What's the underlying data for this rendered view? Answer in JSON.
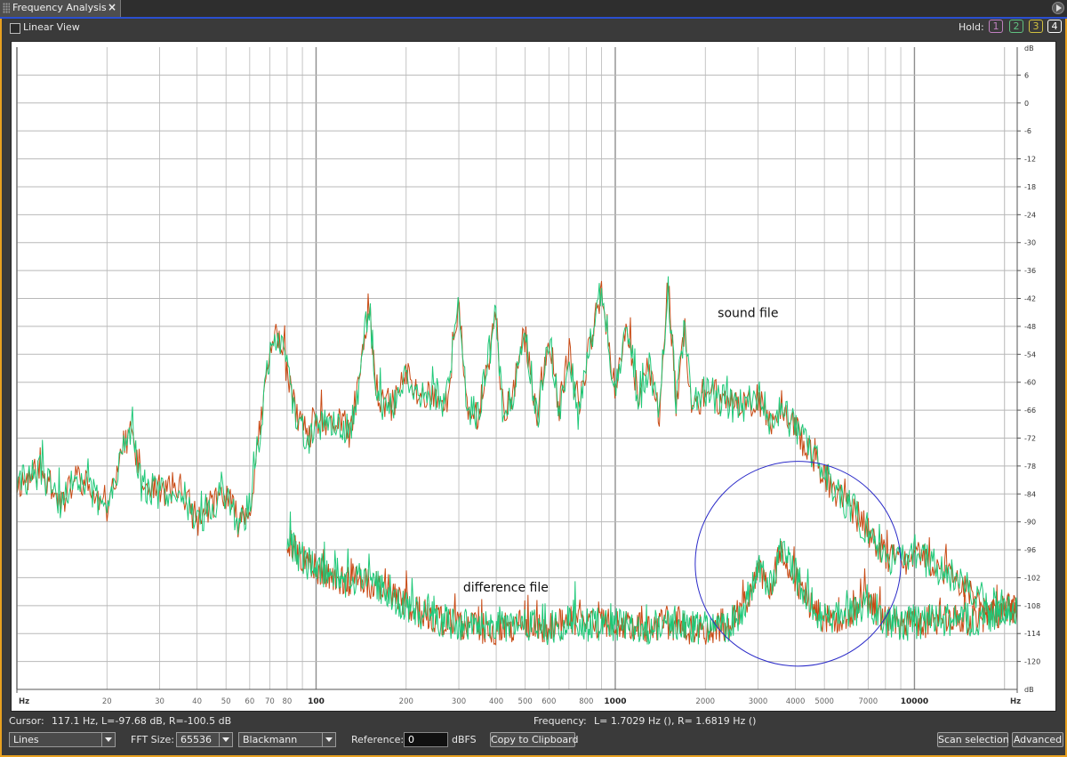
{
  "window": {
    "tab_title": "Frequency Analysis",
    "close_glyph": "×"
  },
  "toolbar": {
    "linear_view_label": "Linear View",
    "hold_label": "Hold:",
    "hold_buttons": [
      {
        "label": "1",
        "color": "#c080c0"
      },
      {
        "label": "2",
        "color": "#60c080"
      },
      {
        "label": "3",
        "color": "#d0c040"
      },
      {
        "label": "4",
        "color": "#ffffff"
      }
    ]
  },
  "status": {
    "cursor_label": "Cursor:",
    "cursor_value": "117.1 Hz, L=-97.68 dB, R=-100.5 dB",
    "frequency_label": "Frequency:",
    "frequency_value": "L= 1.7029 Hz (), R= 1.6819 Hz ()"
  },
  "bottom": {
    "mode_value": "Lines",
    "fft_label": "FFT Size:",
    "fft_value": "65536",
    "window_value": "Blackmann",
    "reference_label": "Reference:",
    "reference_value": "0",
    "reference_unit": "dBFS",
    "copy_label": "Copy to Clipboard",
    "scan_label": "Scan selection",
    "advanced_label": "Advanced"
  },
  "colors": {
    "left_channel": "#c84a14",
    "right_channel": "#1ec878",
    "highlight_ellipse": "#2a2ac8",
    "grid": "#b8b8b8"
  },
  "chart_data": {
    "type": "line",
    "x_scale": "log",
    "xlim": [
      10,
      22050
    ],
    "ylim": [
      -126,
      12
    ],
    "x_unit": "Hz",
    "y_unit": "dB",
    "x_tick_labels": [
      {
        "value": 20,
        "label": "20"
      },
      {
        "value": 30,
        "label": "30"
      },
      {
        "value": 40,
        "label": "40"
      },
      {
        "value": 50,
        "label": "50"
      },
      {
        "value": 60,
        "label": "60"
      },
      {
        "value": 70,
        "label": "70"
      },
      {
        "value": 80,
        "label": "80"
      },
      {
        "value": 100,
        "label": "100"
      },
      {
        "value": 200,
        "label": "200"
      },
      {
        "value": 300,
        "label": "300"
      },
      {
        "value": 400,
        "label": "400"
      },
      {
        "value": 500,
        "label": "500"
      },
      {
        "value": 600,
        "label": "600"
      },
      {
        "value": 800,
        "label": "800"
      },
      {
        "value": 1000,
        "label": "1000"
      },
      {
        "value": 2000,
        "label": "2000"
      },
      {
        "value": 3000,
        "label": "3000"
      },
      {
        "value": 4000,
        "label": "4000"
      },
      {
        "value": 5000,
        "label": "5000"
      },
      {
        "value": 7000,
        "label": "7000"
      },
      {
        "value": 10000,
        "label": "10000"
      }
    ],
    "y_ticks": [
      6,
      0,
      -6,
      -12,
      -18,
      -24,
      -30,
      -36,
      -42,
      -48,
      -54,
      -60,
      -66,
      -72,
      -78,
      -84,
      -90,
      -96,
      -102,
      -108,
      -114,
      -120
    ],
    "annotations": [
      {
        "text": "sound file",
        "x": 2200,
        "y": -46
      },
      {
        "text": "difference file",
        "x": 310,
        "y": -105
      }
    ],
    "highlight_region": {
      "x_from": 1850,
      "x_to": 9000,
      "y_from": -121,
      "y_to": -77
    },
    "series": [
      {
        "id": "sound",
        "points": [
          [
            10,
            -82
          ],
          [
            12,
            -79
          ],
          [
            14,
            -86
          ],
          [
            16,
            -80
          ],
          [
            18,
            -84
          ],
          [
            20,
            -88
          ],
          [
            22,
            -76
          ],
          [
            24,
            -70
          ],
          [
            26,
            -82
          ],
          [
            30,
            -84
          ],
          [
            35,
            -82
          ],
          [
            40,
            -90
          ],
          [
            45,
            -86
          ],
          [
            50,
            -84
          ],
          [
            55,
            -90
          ],
          [
            60,
            -87
          ],
          [
            65,
            -70
          ],
          [
            70,
            -54
          ],
          [
            75,
            -49
          ],
          [
            80,
            -58
          ],
          [
            85,
            -66
          ],
          [
            90,
            -70
          ],
          [
            95,
            -72
          ],
          [
            100,
            -68
          ],
          [
            110,
            -70
          ],
          [
            120,
            -68
          ],
          [
            130,
            -71
          ],
          [
            140,
            -60
          ],
          [
            150,
            -42
          ],
          [
            160,
            -64
          ],
          [
            180,
            -65
          ],
          [
            200,
            -58
          ],
          [
            220,
            -63
          ],
          [
            250,
            -62
          ],
          [
            270,
            -66
          ],
          [
            300,
            -44
          ],
          [
            320,
            -66
          ],
          [
            350,
            -67
          ],
          [
            400,
            -45
          ],
          [
            420,
            -66
          ],
          [
            450,
            -64
          ],
          [
            500,
            -50
          ],
          [
            550,
            -68
          ],
          [
            600,
            -49
          ],
          [
            650,
            -66
          ],
          [
            700,
            -53
          ],
          [
            750,
            -67
          ],
          [
            800,
            -56
          ],
          [
            900,
            -40
          ],
          [
            1000,
            -62
          ],
          [
            1100,
            -48
          ],
          [
            1200,
            -65
          ],
          [
            1300,
            -56
          ],
          [
            1400,
            -68
          ],
          [
            1500,
            -38
          ],
          [
            1600,
            -65
          ],
          [
            1700,
            -48
          ],
          [
            1800,
            -66
          ],
          [
            2000,
            -62
          ],
          [
            2300,
            -64
          ],
          [
            2600,
            -66
          ],
          [
            3000,
            -63
          ],
          [
            3300,
            -68
          ],
          [
            3600,
            -66
          ],
          [
            4000,
            -70
          ],
          [
            4500,
            -75
          ],
          [
            5000,
            -80
          ],
          [
            5500,
            -84
          ],
          [
            6000,
            -86
          ],
          [
            7000,
            -92
          ],
          [
            8000,
            -97
          ],
          [
            9000,
            -99
          ],
          [
            10000,
            -97
          ],
          [
            12000,
            -100
          ],
          [
            14000,
            -102
          ],
          [
            16000,
            -106
          ],
          [
            18000,
            -110
          ],
          [
            20000,
            -109
          ],
          [
            22050,
            -108
          ]
        ]
      },
      {
        "id": "difference",
        "points": [
          [
            80,
            -94
          ],
          [
            90,
            -98
          ],
          [
            100,
            -100
          ],
          [
            110,
            -101
          ],
          [
            120,
            -103
          ],
          [
            140,
            -102
          ],
          [
            160,
            -104
          ],
          [
            180,
            -106
          ],
          [
            200,
            -108
          ],
          [
            250,
            -111
          ],
          [
            300,
            -112
          ],
          [
            350,
            -113
          ],
          [
            400,
            -113
          ],
          [
            500,
            -112
          ],
          [
            600,
            -113
          ],
          [
            700,
            -111
          ],
          [
            800,
            -112
          ],
          [
            1000,
            -112
          ],
          [
            1200,
            -113
          ],
          [
            1500,
            -112
          ],
          [
            1800,
            -113
          ],
          [
            2000,
            -113
          ],
          [
            2300,
            -113
          ],
          [
            2500,
            -111
          ],
          [
            2800,
            -106
          ],
          [
            3000,
            -100
          ],
          [
            3300,
            -104
          ],
          [
            3600,
            -96
          ],
          [
            4000,
            -102
          ],
          [
            4500,
            -108
          ],
          [
            5000,
            -111
          ],
          [
            6000,
            -110
          ],
          [
            7000,
            -107
          ],
          [
            8000,
            -111
          ],
          [
            9000,
            -112
          ],
          [
            10000,
            -112
          ],
          [
            12000,
            -111
          ],
          [
            14000,
            -111
          ],
          [
            16000,
            -111
          ],
          [
            18000,
            -110
          ],
          [
            20000,
            -109
          ],
          [
            22050,
            -109
          ]
        ]
      }
    ]
  }
}
